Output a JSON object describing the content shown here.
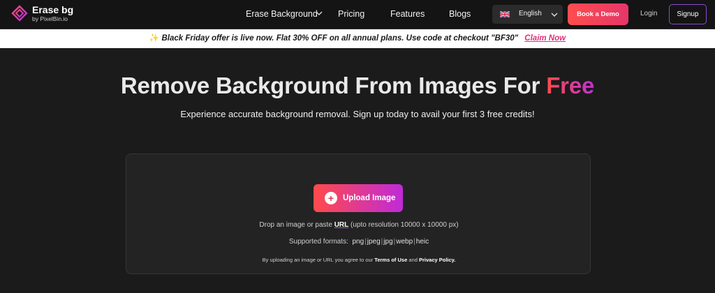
{
  "nav": {
    "logo_title": "Erase bg",
    "logo_sub": "by PixelBin.io",
    "links": [
      "Erase Background",
      "Pricing",
      "Features",
      "Blogs"
    ],
    "language": "English",
    "demo_label": "Book a Demo",
    "login_label": "Login",
    "signup_label": "Signup"
  },
  "banner": {
    "message": "Black Friday offer is live now. Flat 30% OFF on all annual plans. Use code at checkout \"BF30\"",
    "cta": "Claim Now"
  },
  "hero": {
    "title_main": "Remove Background From Images For",
    "title_highlight": "Free",
    "subtitle": "Experience accurate background removal. Sign up today to avail your first 3 free credits!"
  },
  "upload": {
    "button_label": "Upload Image",
    "drop_prefix": "Drop an image or paste",
    "drop_link": "URL",
    "drop_suffix": "(upto resolution 10000 x 10000 px)",
    "formats_label": "Supported formats:",
    "formats": [
      "png",
      "jpeg",
      "jpg",
      "webp",
      "heic"
    ],
    "terms_prefix": "By uploading an image or URL you agree to our",
    "terms_link": "Terms of Use",
    "terms_and": "and",
    "privacy_link": "Privacy Policy."
  },
  "colors": {
    "background": "#1b1b1b",
    "nav_bg": "#141414",
    "accent_red": "#ff4a4a",
    "accent_purple": "#c02ad9",
    "claim_pink": "#e0307b"
  }
}
